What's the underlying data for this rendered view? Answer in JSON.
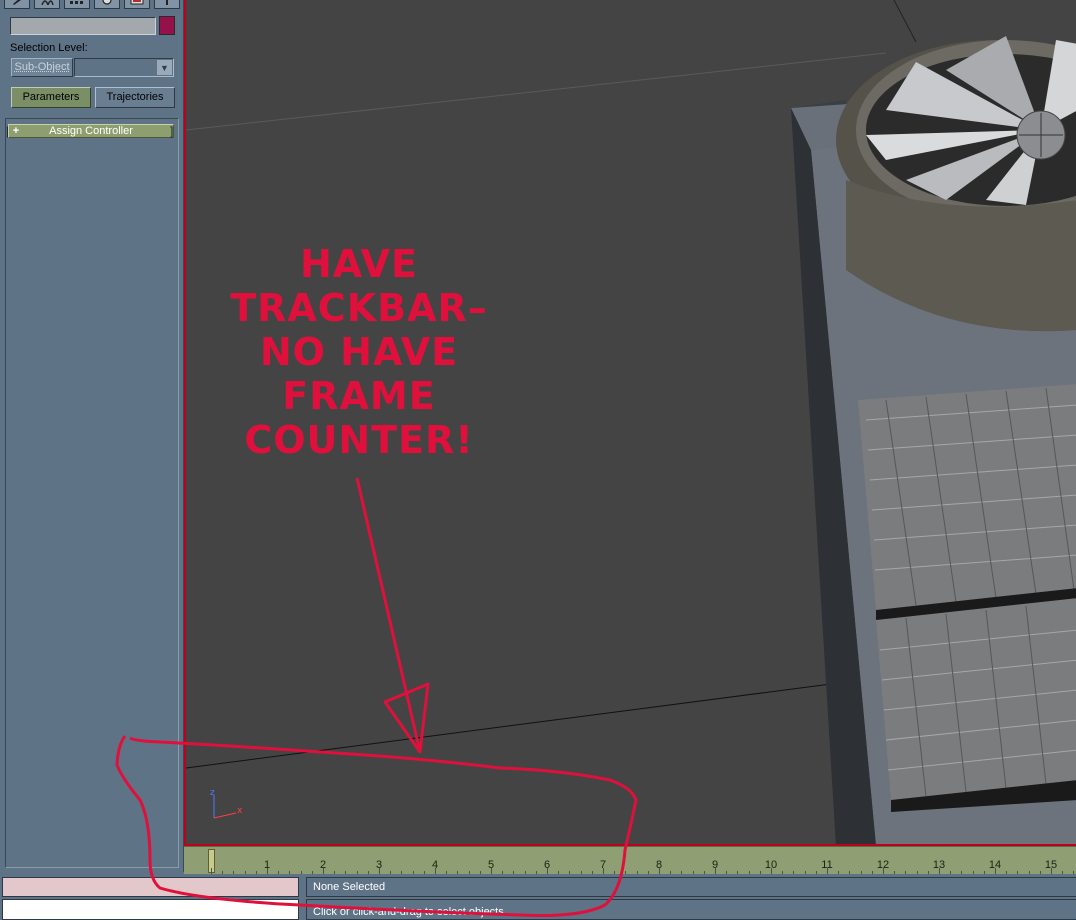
{
  "command_panel": {
    "tabs": [
      {
        "icon": "create-icon"
      },
      {
        "icon": "modify-icon"
      },
      {
        "icon": "hierarchy-icon"
      },
      {
        "icon": "motion-icon"
      },
      {
        "icon": "display-icon"
      },
      {
        "icon": "utilities-icon"
      }
    ],
    "object_name_value": "",
    "object_color": "#96104a",
    "selection_level_label": "Selection Level:",
    "sub_object_button": "Sub-Object",
    "sub_object_dropdown_value": "",
    "parameters_button": "Parameters",
    "trajectories_button": "Trajectories",
    "rollout": {
      "toggle": "+",
      "title": "Assign Controller"
    }
  },
  "viewport": {
    "border_color": "#c0001a",
    "background": "#444444",
    "axis_labels": {
      "z": "z",
      "x": "x"
    }
  },
  "trackbar": {
    "current_frame": 0,
    "frame_labels": [
      "1",
      "2",
      "3",
      "4",
      "5",
      "6",
      "7",
      "8",
      "9",
      "10",
      "11",
      "12",
      "13",
      "14",
      "15"
    ]
  },
  "status_bar": {
    "maxscript_listener_value": "",
    "maxscript_input_value": "",
    "selection_status": "None Selected",
    "prompt_line": "Click or click-and-drag to select objects"
  },
  "annotation": {
    "color": "#e0103c",
    "lines": [
      "HAVE",
      "TRACKBAR–",
      "NO HAVE",
      "FRAME",
      "COUNTER!"
    ]
  }
}
